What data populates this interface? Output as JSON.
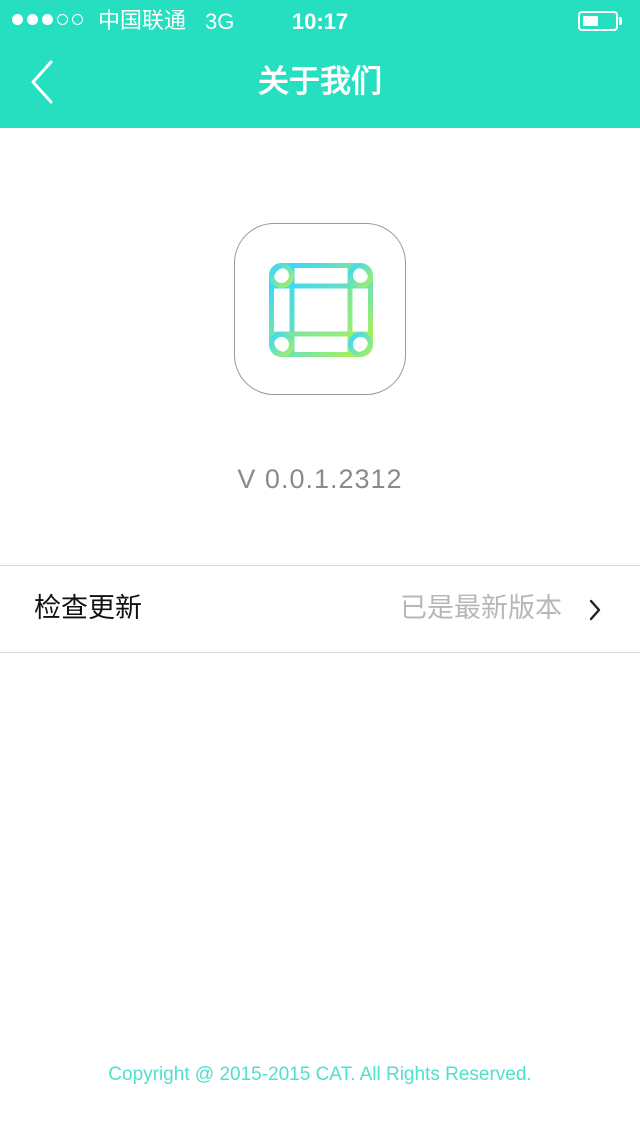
{
  "status_bar": {
    "carrier": "中国联通",
    "network": "3G",
    "time": "10:17",
    "signal_bars_filled": 3,
    "signal_bars_total": 5,
    "battery_level": 0.5
  },
  "nav": {
    "back_icon": "chevron-left-icon",
    "title": "关于我们"
  },
  "app": {
    "icon": "app-logo-icon",
    "version": "V 0.0.1.2312"
  },
  "update": {
    "label": "检查更新",
    "status": "已是最新版本",
    "icon": "chevron-right-icon"
  },
  "footer": {
    "copyright": "Copyright @ 2015-2015 CAT. All Rights Reserved."
  },
  "colors": {
    "header": "#25dfc0",
    "logo_gradient_start": "#39d7ff",
    "logo_gradient_end": "#a7ef61",
    "footer_text": "#4ee0cb"
  }
}
